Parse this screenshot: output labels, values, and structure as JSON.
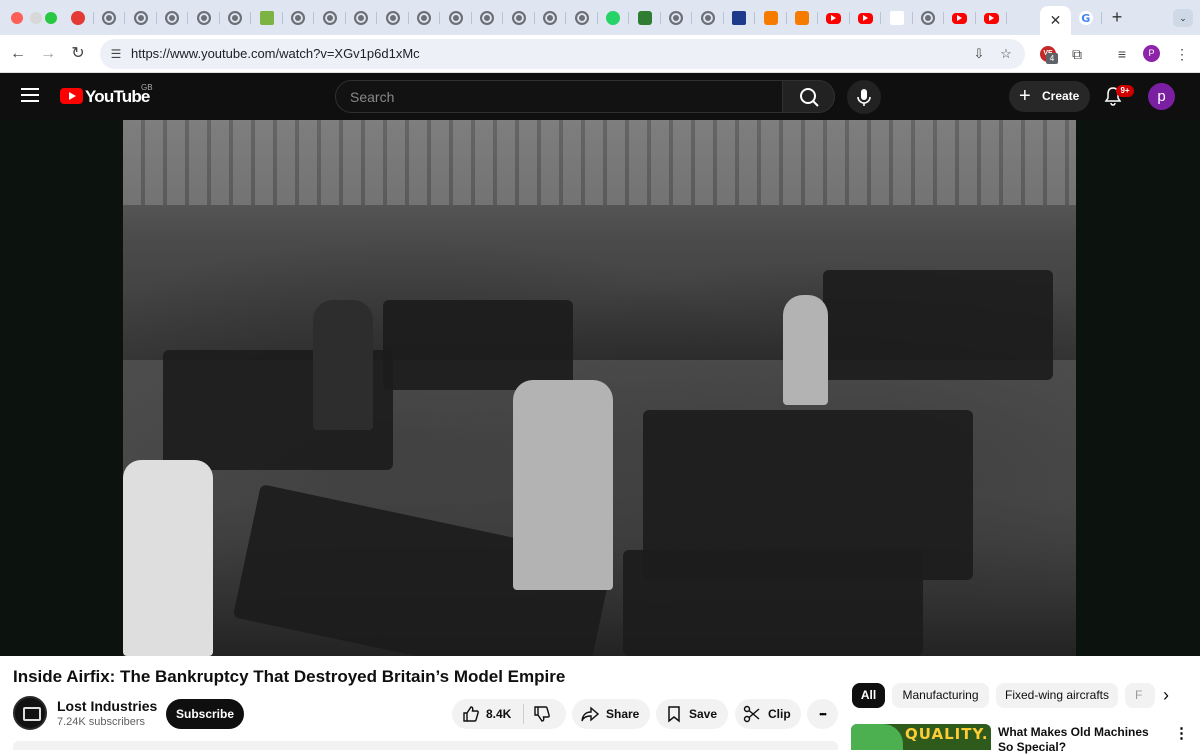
{
  "browser": {
    "tabs": [
      {
        "icon": "heart-icon"
      },
      {
        "icon": "globe-icon"
      },
      {
        "icon": "globe-icon"
      },
      {
        "icon": "globe-icon"
      },
      {
        "icon": "globe-icon"
      },
      {
        "icon": "globe-icon"
      },
      {
        "icon": "green-app-icon"
      },
      {
        "icon": "globe-icon"
      },
      {
        "icon": "globe-icon"
      },
      {
        "icon": "globe-icon"
      },
      {
        "icon": "globe-icon"
      },
      {
        "icon": "globe-icon"
      },
      {
        "icon": "globe-icon"
      },
      {
        "icon": "globe-icon"
      },
      {
        "icon": "globe-icon"
      },
      {
        "icon": "globe-icon"
      },
      {
        "icon": "globe-icon"
      },
      {
        "icon": "whatsapp-icon"
      },
      {
        "icon": "green-search-icon"
      },
      {
        "icon": "globe-icon"
      },
      {
        "icon": "globe-icon"
      },
      {
        "icon": "flag-icon"
      },
      {
        "icon": "orange-app-icon"
      },
      {
        "icon": "orange-app-icon"
      },
      {
        "icon": "youtube-icon"
      },
      {
        "icon": "youtube-icon"
      },
      {
        "icon": "mk-icon"
      },
      {
        "icon": "globe-icon"
      },
      {
        "icon": "youtube-icon"
      },
      {
        "icon": "youtube-icon"
      }
    ],
    "active_tab": {
      "icon": "close-icon",
      "close_symbol": "✕"
    },
    "new_tab_symbol": "+",
    "google_tab": {
      "icon": "google-icon",
      "letter": "G"
    },
    "tab_menu_symbol": "⌄",
    "url": "https://www.youtube.com/watch?v=XGv1p6d1xMc",
    "extension_badge": "VE",
    "extension_count": "4",
    "profile_initial": "P"
  },
  "youtube": {
    "logo_text": "YouTube",
    "region": "GB",
    "search_placeholder": "Search",
    "create_label": "Create",
    "create_symbol": "+",
    "notifications": "9+",
    "avatar_initial": "p",
    "video": {
      "title": "Inside Airfix: The Bankruptcy That Destroyed Britain’s Model Empire",
      "channel": "Lost Industries",
      "subscribers": "7.24K subscribers",
      "subscribe_label": "Subscribe",
      "likes": "8.4K",
      "share_label": "Share",
      "save_label": "Save",
      "clip_label": "Clip",
      "more_symbol": "•••"
    },
    "chips": [
      "All",
      "Manufacturing",
      "Fixed-wing aircrafts",
      "F"
    ],
    "chip_next_symbol": "›",
    "related": [
      {
        "thumb_text": "QUALITY.",
        "title": "What Makes Old Machines So Special?"
      }
    ]
  },
  "colors": {
    "youtube_red": "#ff0000",
    "masthead": "#0f0f0f",
    "player_background": "#0c130f",
    "chrome_tabstrip": "#dfe6f1"
  }
}
